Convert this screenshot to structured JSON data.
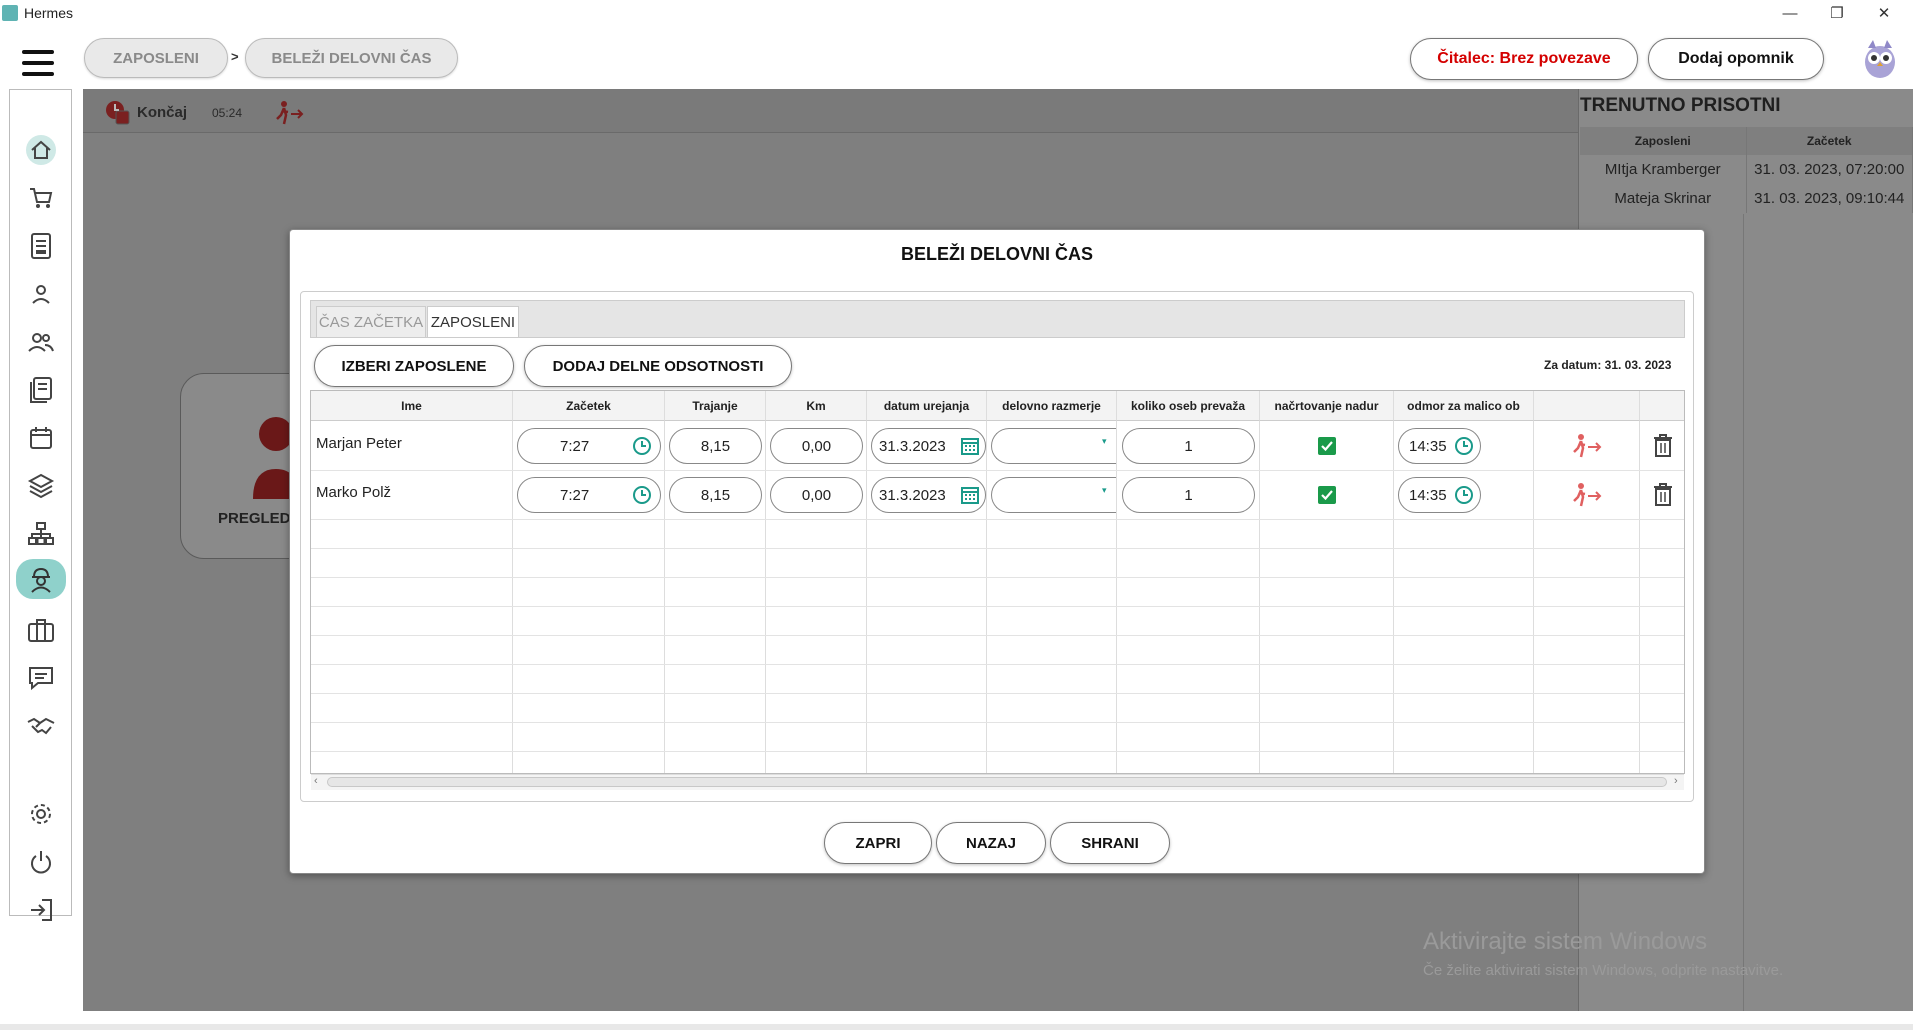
{
  "window": {
    "title": "Hermes",
    "minimize": "—",
    "restore": "❐",
    "close": "✕"
  },
  "breadcrumb": {
    "items": [
      "ZAPOSLENI",
      "BELEŽI DELOVNI ČAS"
    ],
    "separator": ">"
  },
  "header": {
    "reader_status": "Čitalec: Brez povezave",
    "add_reminder": "Dodaj opomnik"
  },
  "sidebar": {
    "items": [
      {
        "icon": "home-icon"
      },
      {
        "icon": "cart-icon"
      },
      {
        "icon": "document-icon"
      },
      {
        "icon": "person-icon"
      },
      {
        "icon": "people-icon"
      },
      {
        "icon": "list-icon"
      },
      {
        "icon": "calendar-icon"
      },
      {
        "icon": "layers-icon"
      },
      {
        "icon": "hierarchy-icon"
      },
      {
        "icon": "worker-icon",
        "active": true
      },
      {
        "icon": "briefcase-icon"
      },
      {
        "icon": "chat-icon"
      },
      {
        "icon": "handshake-icon"
      },
      {
        "icon": "gear-icon"
      },
      {
        "icon": "power-icon"
      },
      {
        "icon": "logout-icon"
      }
    ]
  },
  "toolbar": {
    "end_label": "Končaj",
    "elapsed": "05:24"
  },
  "card": {
    "label": "PREGLED"
  },
  "presence": {
    "title": "TRENUTNO PRISOTNI",
    "columns": [
      "Zaposleni",
      "Začetek"
    ],
    "rows": [
      [
        "MItja Kramberger",
        "31. 03. 2023, 07:20:00"
      ],
      [
        "Mateja Skrinar",
        "31. 03. 2023, 09:10:44"
      ]
    ]
  },
  "modal": {
    "title": "BELEŽI DELOVNI ČAS",
    "tabs": [
      "ČAS ZAČETKA",
      "ZAPOSLENI"
    ],
    "active_tab": "ZAPOSLENI",
    "select_button": "IZBERI ZAPOSLENE",
    "absence_button": "DODAJ DELNE ODSOTNOSTI",
    "date_label": "Za datum: 31. 03. 2023",
    "columns": [
      "Ime",
      "Začetek",
      "Trajanje",
      "Km",
      "datum urejanja",
      "delovno razmerje",
      "koliko oseb prevaža",
      "načrtovanje nadur",
      "odmor za malico ob"
    ],
    "rows": [
      {
        "name": "Marjan Peter",
        "start": "7:27",
        "duration": "8,15",
        "km": "0,00",
        "date": "31.3.2023",
        "relation": "",
        "passengers": "1",
        "overtime": true,
        "lunch": "14:35"
      },
      {
        "name": "Marko Polž",
        "start": "7:27",
        "duration": "8,15",
        "km": "0,00",
        "date": "31.3.2023",
        "relation": "",
        "passengers": "1",
        "overtime": true,
        "lunch": "14:35"
      }
    ],
    "footer": {
      "close": "ZAPRI",
      "back": "NAZAJ",
      "save": "SHRANI"
    }
  },
  "watermark": {
    "line1": "Aktivirajte sistem Windows",
    "line2": "Če želite aktivirati sistem Windows, odprite nastavitve."
  },
  "colors": {
    "accent": "#1a9a8a",
    "danger": "#d40000",
    "checkbox": "#1a9a4a",
    "active_side": "#8fd1cb"
  }
}
